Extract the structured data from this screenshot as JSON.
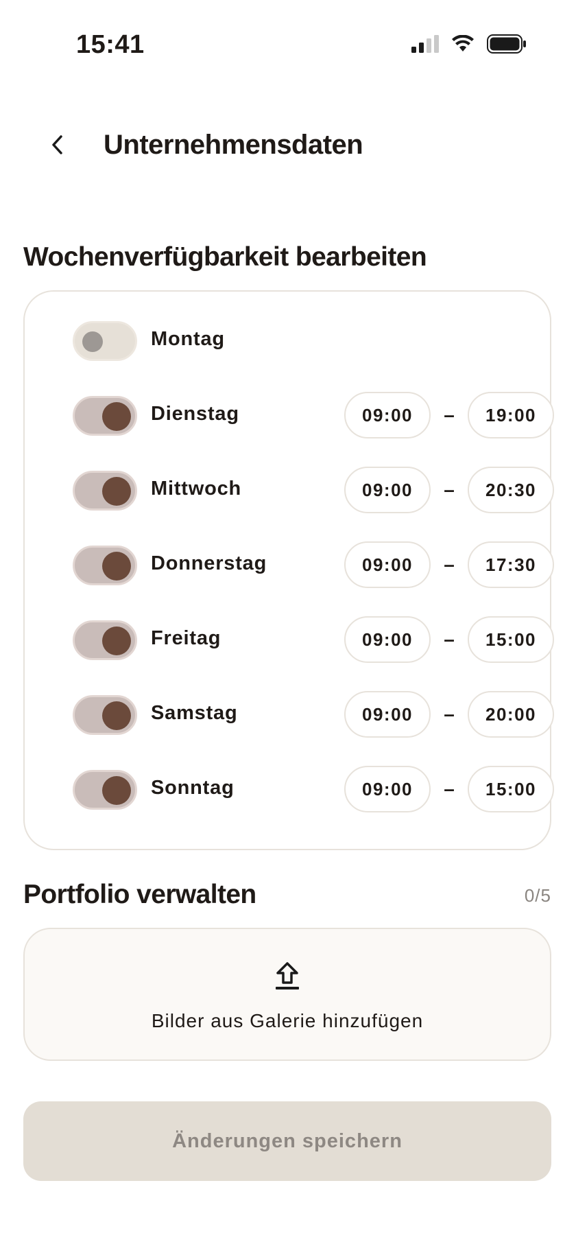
{
  "status_bar": {
    "time": "15:41"
  },
  "header": {
    "title": "Unternehmensdaten"
  },
  "availability": {
    "title": "Wochenverfügbarkeit bearbeiten",
    "days": [
      {
        "label": "Montag",
        "enabled": false,
        "from": "",
        "to": ""
      },
      {
        "label": "Dienstag",
        "enabled": true,
        "from": "09:00",
        "to": "19:00"
      },
      {
        "label": "Mittwoch",
        "enabled": true,
        "from": "09:00",
        "to": "20:30"
      },
      {
        "label": "Donnerstag",
        "enabled": true,
        "from": "09:00",
        "to": "17:30"
      },
      {
        "label": "Freitag",
        "enabled": true,
        "from": "09:00",
        "to": "15:00"
      },
      {
        "label": "Samstag",
        "enabled": true,
        "from": "09:00",
        "to": "20:00"
      },
      {
        "label": "Sonntag",
        "enabled": true,
        "from": "09:00",
        "to": "15:00"
      }
    ],
    "separator": "–"
  },
  "portfolio": {
    "title": "Portfolio verwalten",
    "count": "0/5",
    "upload_label": "Bilder aus Galerie hinzufügen"
  },
  "save_button": {
    "label": "Änderungen speichern"
  },
  "colors": {
    "accent": "#6b4a3b",
    "toggle_track_on": "#c9bcb9",
    "button_disabled": "#e3ddd4"
  }
}
